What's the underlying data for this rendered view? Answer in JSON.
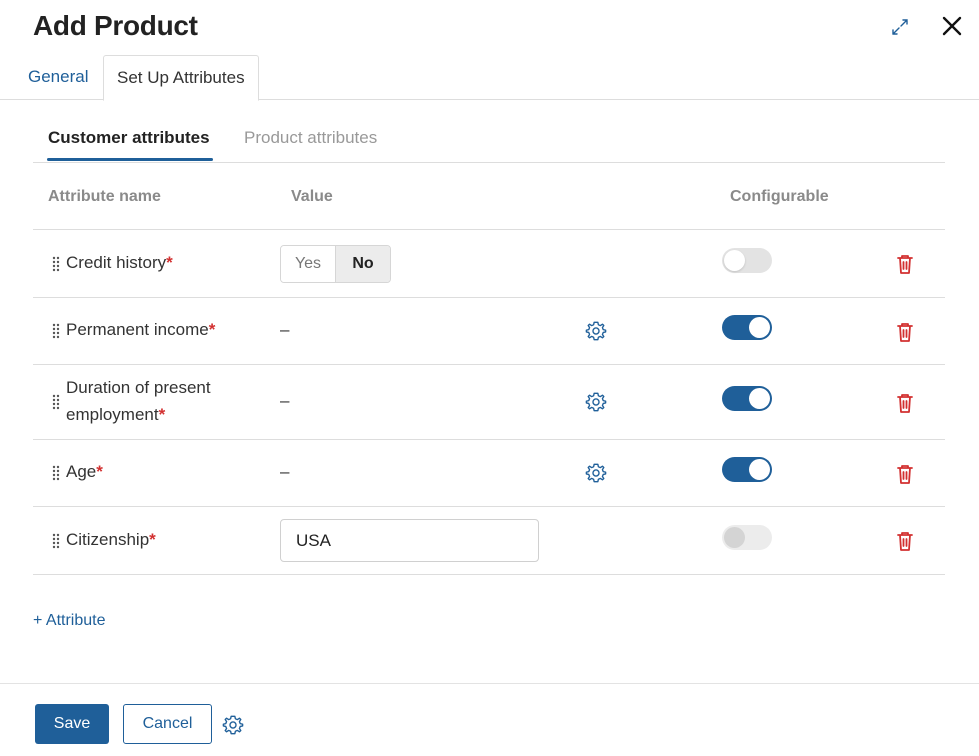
{
  "dialog": {
    "title": "Add Product",
    "expand_icon": "expand-icon",
    "close_icon": "close-icon"
  },
  "main_tabs": [
    {
      "label": "General",
      "active": false
    },
    {
      "label": "Set Up Attributes",
      "active": true
    }
  ],
  "sub_tabs": [
    {
      "label": "Customer attributes",
      "active": true
    },
    {
      "label": "Product attributes",
      "active": false
    }
  ],
  "table": {
    "headers": {
      "name": "Attribute name",
      "value": "Value",
      "configurable": "Configurable"
    },
    "rows": [
      {
        "name": "Credit history",
        "required_mark": "*",
        "value_type": "yes-no",
        "yes_label": "Yes",
        "no_label": "No",
        "selected": "No",
        "configurable": false
      },
      {
        "name": "Permanent income",
        "required_mark": "*",
        "value": "–",
        "configurable": true
      },
      {
        "name_line1": "Duration of present",
        "name_line2": "employment",
        "required_mark": "*",
        "value": "–",
        "configurable": true
      },
      {
        "name": "Age",
        "required_mark": "*",
        "value": "–",
        "configurable": true
      },
      {
        "name": "Citizenship",
        "required_mark": "*",
        "value": "USA",
        "configurable": false,
        "configurable_disabled": true
      }
    ]
  },
  "add_attribute_label": "+ Attribute",
  "footer": {
    "save_label": "Save",
    "cancel_label": "Cancel"
  },
  "colors": {
    "accent": "#1f5f99",
    "required": "#d23030",
    "delete": "#d23030"
  }
}
